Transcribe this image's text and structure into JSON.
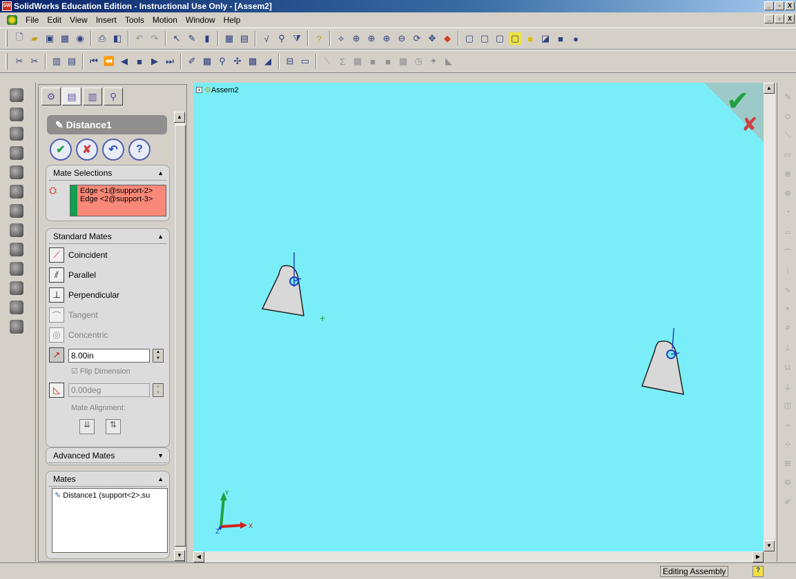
{
  "window": {
    "title": "SolidWorks Education Edition - Instructional Use Only - [Assem2]",
    "app_icon_text": "SW",
    "buttons": [
      "_",
      "▫",
      "X"
    ]
  },
  "menu": [
    "File",
    "Edit",
    "View",
    "Insert",
    "Tools",
    "Motion",
    "Window",
    "Help"
  ],
  "tree": {
    "root": "Assem2"
  },
  "property_manager": {
    "feature_name": "Distance1",
    "buttons": [
      "ok",
      "cancel",
      "undo",
      "help"
    ],
    "mate_selections": {
      "title": "Mate Selections",
      "items": [
        "Edge <1@support-2>",
        "Edge <2@support-3>"
      ]
    },
    "standard_mates": {
      "title": "Standard Mates",
      "items": [
        {
          "label": "Coincident",
          "enabled": true
        },
        {
          "label": "Parallel",
          "enabled": true
        },
        {
          "label": "Perpendicular",
          "enabled": true
        },
        {
          "label": "Tangent",
          "enabled": false
        },
        {
          "label": "Concentric",
          "enabled": false
        }
      ],
      "distance_value": "8.00in",
      "flip_dimension": "Flip Dimension",
      "angle_value": "0.00deg",
      "mate_alignment": "Mate Alignment:"
    },
    "advanced_mates": {
      "title": "Advanced Mates"
    },
    "mates": {
      "title": "Mates",
      "items": [
        "Distance1 (support<2>,su"
      ]
    }
  },
  "status": {
    "text": "Editing Assembly",
    "help": "?"
  },
  "colors": {
    "viewport": "#7aeef8",
    "selection_bg": "#f88878",
    "ok_green": "#20a040",
    "cancel_red": "#d04040"
  }
}
